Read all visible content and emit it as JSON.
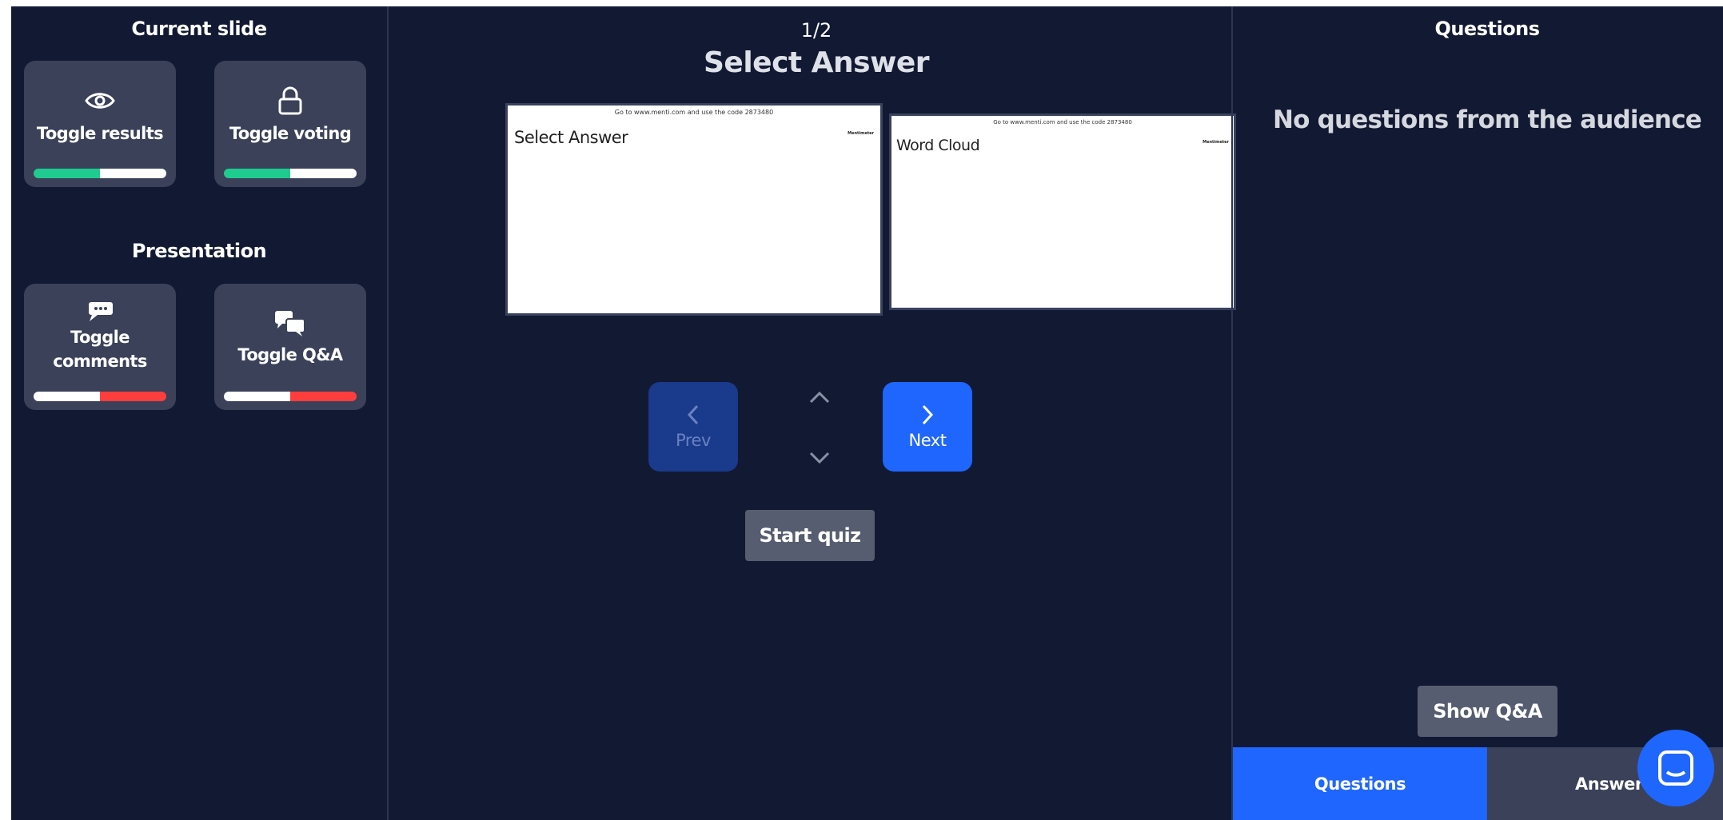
{
  "left_panel": {
    "current_slide_title": "Current slide",
    "presentation_title": "Presentation",
    "toggles": [
      {
        "label": "Toggle results",
        "icon": "eye-icon",
        "state": "on"
      },
      {
        "label": "Toggle voting",
        "icon": "lock-icon",
        "state": "on"
      },
      {
        "label_line1": "Toggle",
        "label_line2": "comments",
        "icon": "comment-icon",
        "state": "off"
      },
      {
        "label": "Toggle Q&A",
        "icon": "chat-bubbles-icon",
        "state": "off"
      }
    ]
  },
  "center_panel": {
    "slide_counter": "1/2",
    "current_slide_title": "Select Answer",
    "slides": [
      {
        "code_line": "Go to www.menti.com and use the code 2873480",
        "title": "Select Answer",
        "brand": "Mentimeter"
      },
      {
        "code_line": "Go to www.menti.com and use the code 2873480",
        "title": "Word Cloud",
        "brand": "Mentimeter"
      }
    ],
    "prev_label": "Prev",
    "next_label": "Next",
    "start_quiz_label": "Start quiz"
  },
  "right_panel": {
    "title": "Questions",
    "empty_message": "No questions from the audience",
    "show_qa_label": "Show Q&A",
    "tabs": [
      {
        "label": "Questions",
        "active": true
      },
      {
        "label": "Answered",
        "active": false
      }
    ]
  },
  "colors": {
    "background": "#121933",
    "card": "#3a4159",
    "primary_blue": "#1f66ff",
    "disabled_blue": "#1a3a8c",
    "toggle_on": "#1fcb8e",
    "toggle_off": "#ff3d3d",
    "gray_button": "#575d70"
  }
}
